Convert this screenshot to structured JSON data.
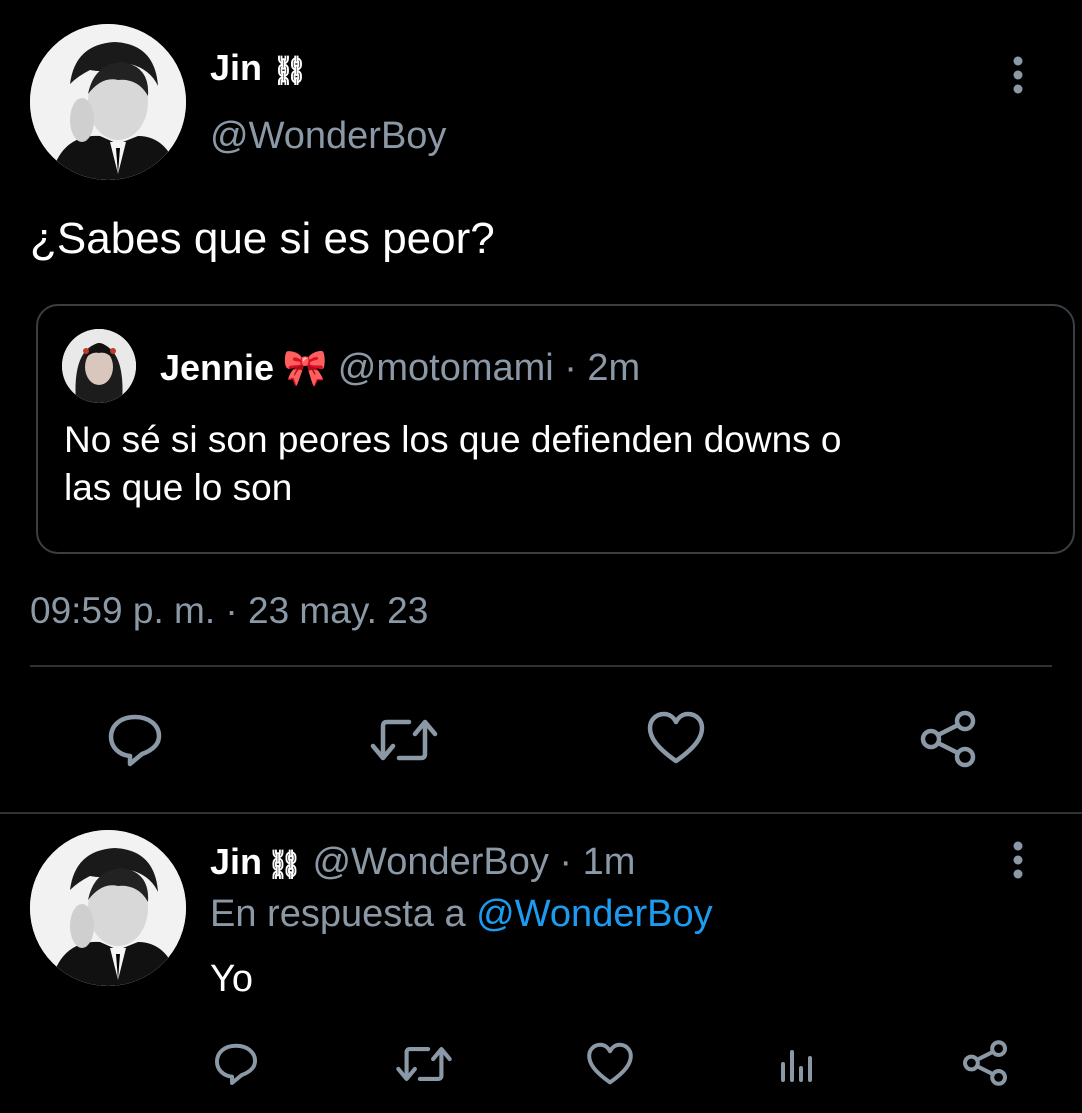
{
  "tweet": {
    "author_name": "Jin",
    "author_badge": "⛓",
    "handle": "@WonderBoy",
    "text": "¿Sabes que si es peor?",
    "timestamp": "09:59 p. m. · 23 may. 23",
    "more_icon": "more-vertical-icon"
  },
  "quote": {
    "author_name": "Jennie",
    "emoji": "🎀",
    "handle": "@motomami",
    "time": "· 2m",
    "text_line1": "No sé si son peores los que defienden downs o",
    "text_line2": "las que lo son"
  },
  "actions": [
    "reply-icon",
    "retweet-icon",
    "like-icon",
    "share-icon"
  ],
  "reply": {
    "author_name": "Jin",
    "author_badge": "⛓",
    "handle": "@WonderBoy",
    "time": "· 1m",
    "in_reply_prefix": "En respuesta a",
    "in_reply_handle": "@WonderBoy",
    "text": "Yo",
    "actions": [
      "reply-icon",
      "retweet-icon",
      "like-icon",
      "analytics-icon",
      "share-icon"
    ]
  },
  "colors": {
    "background": "#000000",
    "text": "#e7e9ea",
    "muted": "#8b98a5",
    "link": "#1d9bf0",
    "border": "#2f3336"
  }
}
